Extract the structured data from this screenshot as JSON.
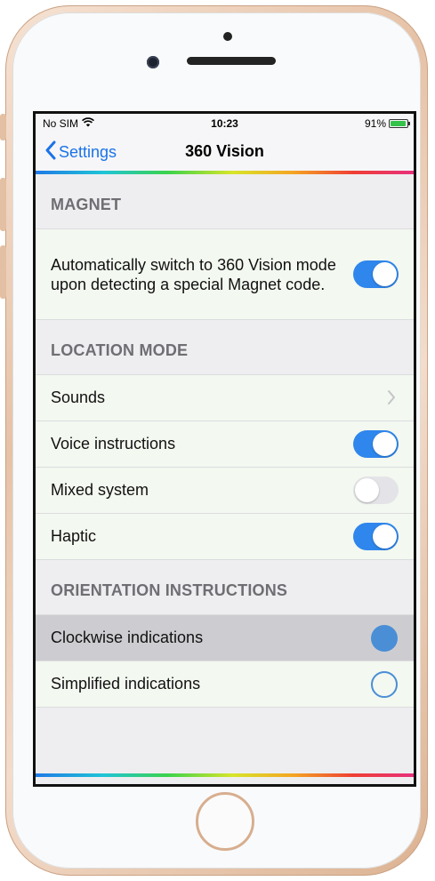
{
  "status_bar": {
    "carrier": "No SIM",
    "time": "10:23",
    "battery": "91%"
  },
  "nav": {
    "back_label": "Settings",
    "title": "360 Vision"
  },
  "sections": {
    "magnet": {
      "header": "MAGNET",
      "description": "Automatically switch to 360 Vision mode upon detecting a special Magnet code.",
      "toggle_on": true
    },
    "location_mode": {
      "header": "LOCATION MODE",
      "rows": [
        {
          "label": "Sounds",
          "control": "chevron"
        },
        {
          "label": "Voice instructions",
          "control": "toggle",
          "on": true
        },
        {
          "label": "Mixed system",
          "control": "toggle",
          "on": false
        },
        {
          "label": "Haptic",
          "control": "toggle",
          "on": true
        }
      ]
    },
    "orientation": {
      "header": "ORIENTATION INSTRUCTIONS",
      "rows": [
        {
          "label": "Clockwise indications",
          "selected": true
        },
        {
          "label": "Simplified indications",
          "selected": false
        }
      ]
    }
  },
  "colors": {
    "accent": "#2f86ec",
    "radio": "#4a8ed6",
    "row_bg": "#f3f8f0",
    "section_bg": "#eeeef0"
  },
  "icons": {
    "wifi": "wifi-icon",
    "battery": "battery-icon",
    "back": "chevron-left-icon",
    "disclosure": "chevron-right-icon"
  }
}
